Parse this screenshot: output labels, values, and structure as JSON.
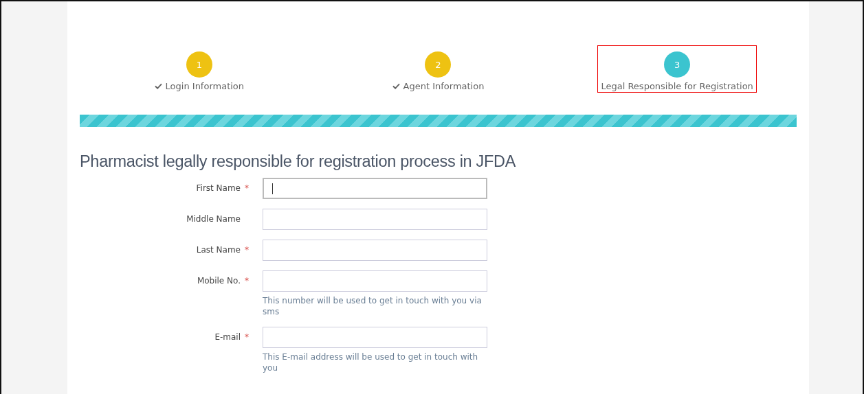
{
  "steps": [
    {
      "number": "1",
      "label": "Login Information",
      "completed": true,
      "highlighted": false,
      "color": "#eec212"
    },
    {
      "number": "2",
      "label": "Agent Information",
      "completed": true,
      "highlighted": false,
      "color": "#eec212"
    },
    {
      "number": "3",
      "label": "Legal Responsible for Registration",
      "completed": false,
      "highlighted": true,
      "color": "#3bc4cf"
    }
  ],
  "heading": "Pharmacist legally responsible for registration process in JFDA",
  "fields": [
    {
      "label": "First Name",
      "marker": "*",
      "focused": true
    },
    {
      "label": "Middle Name",
      "focused": false
    },
    {
      "label": "Last Name",
      "marker": "*",
      "focused": false
    },
    {
      "label": "Mobile No.",
      "marker": "*",
      "focused": false,
      "help": "This number will be used to get in touch with you via sms"
    },
    {
      "label": "E-mail",
      "marker": "*",
      "focused": false,
      "help": "This E-mail address will be used to get in touch with you"
    }
  ]
}
